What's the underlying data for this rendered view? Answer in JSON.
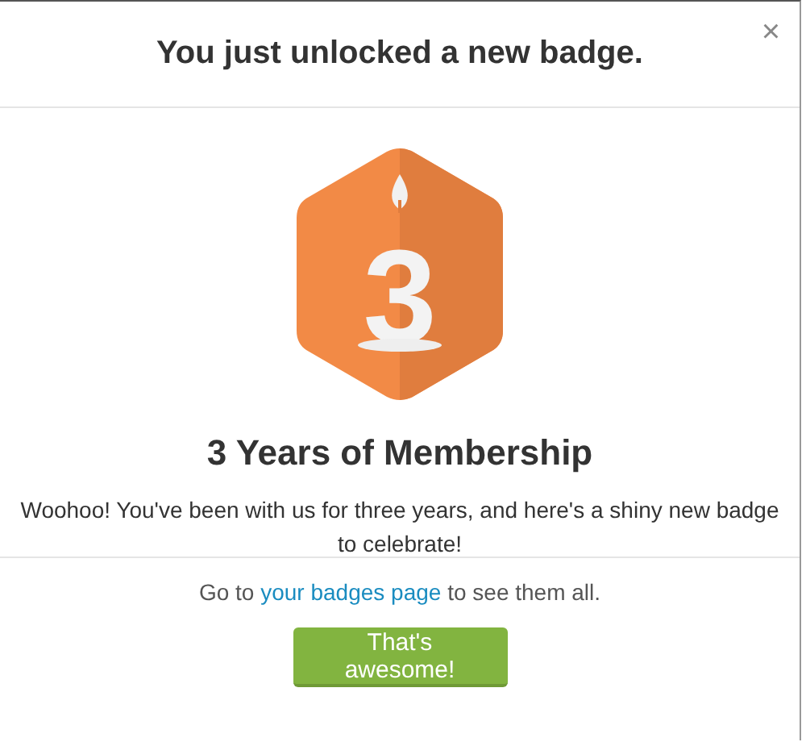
{
  "dialog": {
    "title": "You just unlocked a new badge.",
    "close": "×"
  },
  "badge": {
    "numeral": "3",
    "name": "3 Years of Membership",
    "description": "Woohoo! You've been with us for three years, and here's a shiny new badge to celebrate!"
  },
  "footer": {
    "text_before": "Go to ",
    "link": "your badges page",
    "text_after": " to see them all.",
    "button": "That's awesome!"
  }
}
